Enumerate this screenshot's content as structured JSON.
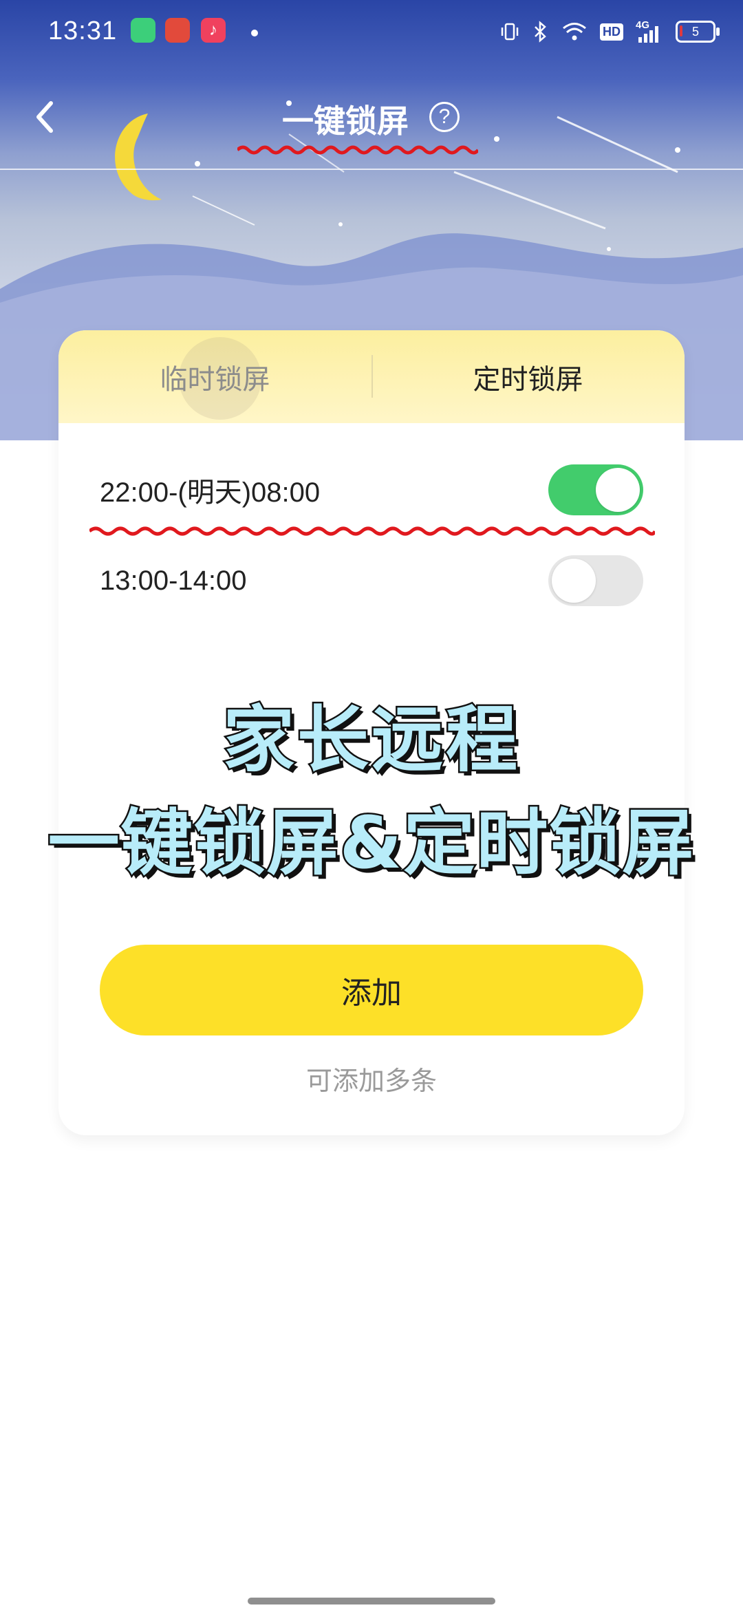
{
  "status_bar": {
    "time": "13:31",
    "battery_level": "5",
    "network": "4G",
    "hd_label": "HD",
    "icons": [
      "battery-saver-app-icon",
      "game-app-icon",
      "music-app-icon",
      "notification-dot",
      "vibrate-icon",
      "bluetooth-icon",
      "wifi-icon",
      "hd-icon",
      "signal-icon",
      "battery-icon"
    ]
  },
  "header": {
    "title": "一键锁屏",
    "back_icon": "chevron-left-icon",
    "help_icon": "?"
  },
  "tabs": [
    {
      "label": "临时锁屏",
      "active": false
    },
    {
      "label": "定时锁屏",
      "active": true
    }
  ],
  "schedules": [
    {
      "label": "22:00-(明天)08:00",
      "enabled": true
    },
    {
      "label": "13:00-14:00",
      "enabled": false
    }
  ],
  "promo": {
    "line1": "家长远程",
    "line2": "一键锁屏&定时锁屏"
  },
  "add_button": {
    "label": "添加"
  },
  "add_hint": "可添加多条",
  "colors": {
    "accent_yellow": "#fde028",
    "toggle_on": "#42cc6c",
    "toggle_off": "#e6e6e6",
    "header_blue": "#2a45a6",
    "annotation_red": "#e0191e"
  }
}
